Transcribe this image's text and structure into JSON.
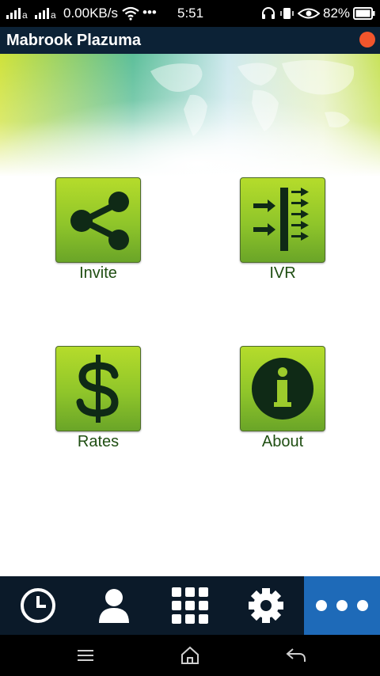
{
  "status_bar": {
    "network_speed": "0.00KB/s",
    "more": "•••",
    "time": "5:51",
    "battery": "82%"
  },
  "app": {
    "title": "Mabrook Plazuma",
    "notification_color": "#f2552c"
  },
  "tiles": [
    {
      "label": "Invite",
      "icon": "share-icon"
    },
    {
      "label": "IVR",
      "icon": "ivr-icon"
    },
    {
      "label": "Rates",
      "icon": "dollar-icon"
    },
    {
      "label": "About",
      "icon": "info-icon"
    }
  ],
  "bottom_nav": [
    {
      "icon": "clock-icon"
    },
    {
      "icon": "contacts-icon"
    },
    {
      "icon": "dialpad-icon"
    },
    {
      "icon": "gear-icon"
    },
    {
      "icon": "more-icon",
      "active": true
    }
  ],
  "colors": {
    "title_bar": "#0c2236",
    "tile_green": "#8fc52a",
    "label_green": "#1f4e12",
    "active_tab": "#1e6ab8"
  }
}
